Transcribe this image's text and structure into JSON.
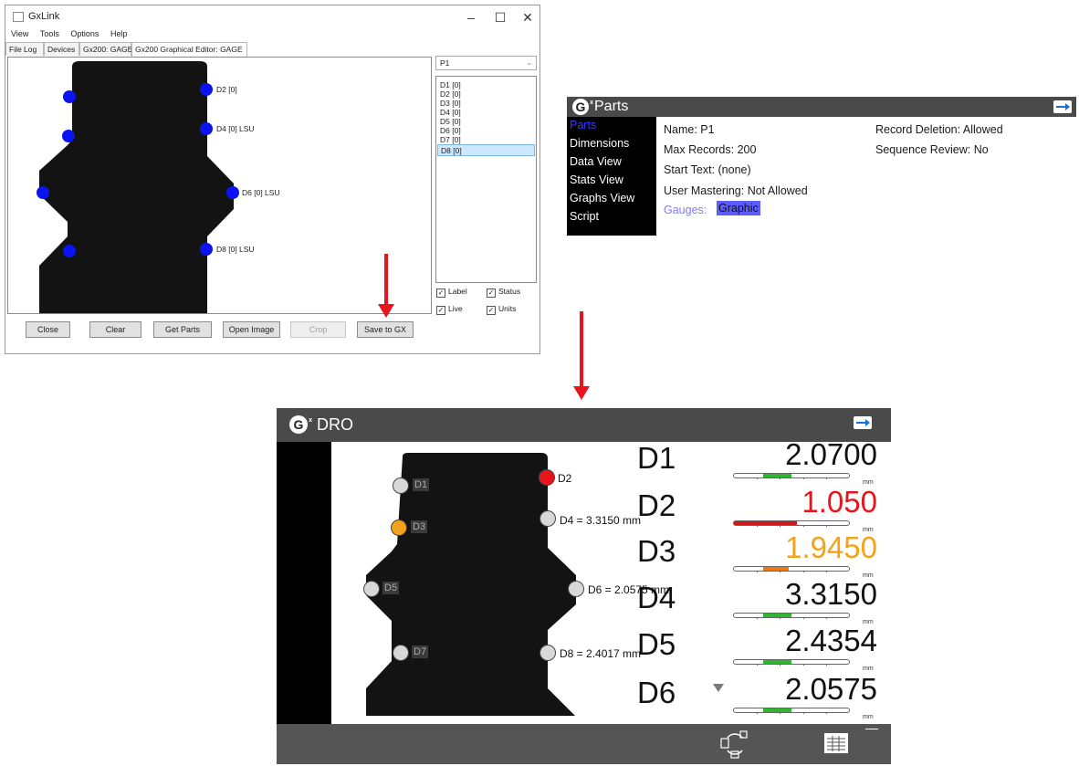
{
  "gxlink": {
    "title": "GxLink",
    "menu": [
      "View",
      "Tools",
      "Options",
      "Help"
    ],
    "tabs": [
      "File Log",
      "Devices",
      "Gx200: GAGE",
      "Gx200 Graphical Editor: GAGE"
    ],
    "canvas_labels": {
      "d2": "D2 [0]",
      "d4": "D4 [0] LSU",
      "d6": "D6 [0] LSU",
      "d8": "D8 [0] LSU"
    },
    "part_select": "P1",
    "dimension_list": [
      "D1 [0]",
      "D2 [0]",
      "D3 [0]",
      "D4 [0]",
      "D5 [0]",
      "D6 [0]",
      "D7 [0]",
      "D8 [0]"
    ],
    "selected_dimension": "D8 [0]",
    "checkboxes": {
      "label": "Label",
      "status": "Status",
      "live": "Live",
      "units": "Units"
    },
    "buttons": {
      "close": "Close",
      "clear": "Clear",
      "get_parts": "Get Parts",
      "open_image": "Open Image",
      "crop": "Crop",
      "save": "Save to GX"
    }
  },
  "parts": {
    "title": "Parts",
    "nav": [
      "Parts",
      "Dimensions",
      "Data View",
      "Stats View",
      "Graphs View",
      "Script"
    ],
    "fields": {
      "name": "Name:  P1",
      "max_records": "Max Records:  200",
      "start_text": "Start Text:  (none)",
      "user_mastering": "User Mastering:  Not Allowed",
      "gauges_label": "Gauges:",
      "gauges_value": "Graphic",
      "record_deletion": "Record Deletion:  Allowed",
      "sequence_review": "Sequence Review:  No"
    }
  },
  "dro": {
    "title": "DRO",
    "image_chips": [
      "D1",
      "D3",
      "D5",
      "D7"
    ],
    "image_labels": {
      "d2": "D2",
      "d4": "D4 = 3.3150 mm",
      "d6": "D6 = 2.0575 mm",
      "d8": "D8 = 2.4017 mm"
    },
    "readings": [
      {
        "name": "D1",
        "value": "2.0700",
        "unit": "mm",
        "color": "#111111",
        "bar_fill": 0.45,
        "bar_color": "#2fb52f",
        "state": "ok"
      },
      {
        "name": "D2",
        "value": "1.050",
        "unit": "mm",
        "color": "#e8141c",
        "bar_fill": 0.55,
        "bar_color": "#d01818",
        "state": "out-of-tolerance"
      },
      {
        "name": "D3",
        "value": "1.9450",
        "unit": "mm",
        "color": "#f5a21b",
        "bar_fill": 0.4,
        "bar_color": "#e87a1a",
        "state": "warning"
      },
      {
        "name": "D4",
        "value": "3.3150",
        "unit": "mm",
        "color": "#111111",
        "bar_fill": 0.45,
        "bar_color": "#2fb52f",
        "state": "ok"
      },
      {
        "name": "D5",
        "value": "2.4354",
        "unit": "mm",
        "color": "#111111",
        "bar_fill": 0.45,
        "bar_color": "#2fb52f",
        "state": "ok"
      },
      {
        "name": "D6",
        "value": "2.0575",
        "unit": "mm",
        "color": "#111111",
        "bar_fill": 0.45,
        "bar_color": "#2fb52f",
        "state": "ok"
      }
    ]
  },
  "icons": {
    "logo": "gx-logo-icon",
    "exit": "exit-arrow-icon",
    "cycle": "cycle-part-icon",
    "grid": "data-grid-icon",
    "scroll": "scroll-down-triangle-icon"
  }
}
